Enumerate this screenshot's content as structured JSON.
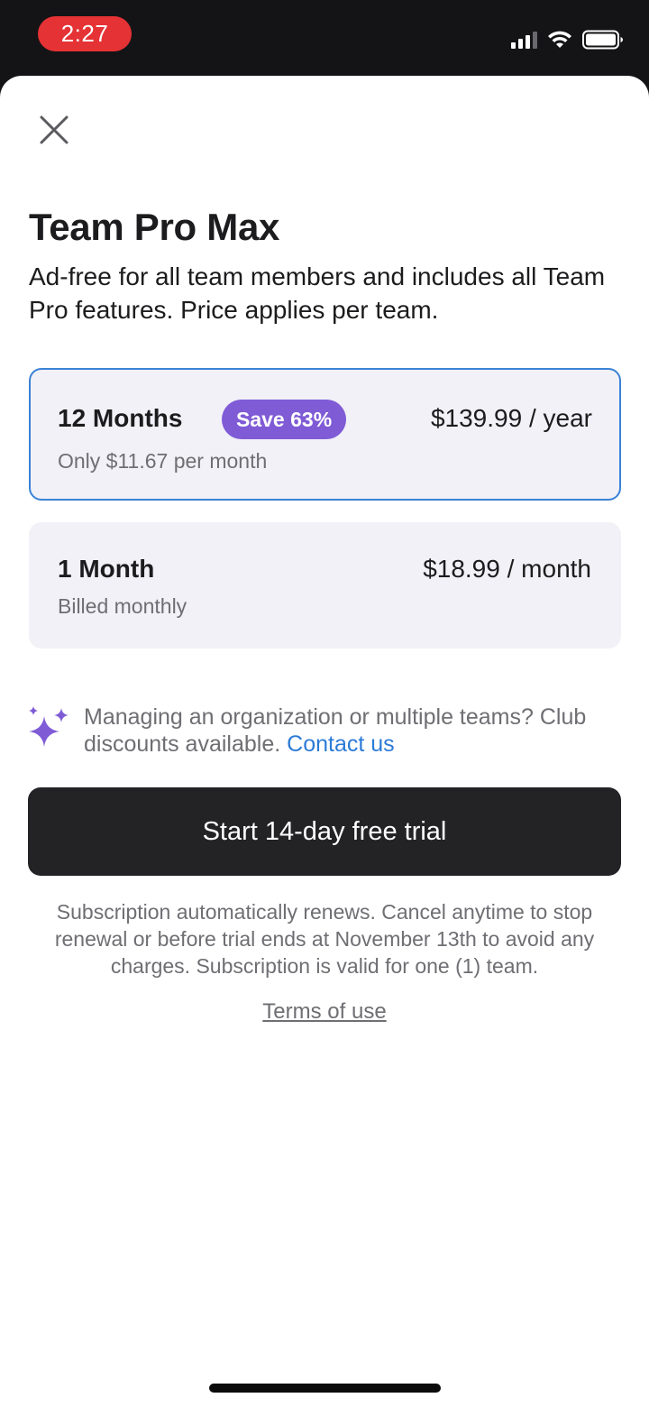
{
  "status_bar": {
    "time": "2:27",
    "icons": [
      "signal-icon",
      "wifi-icon",
      "battery-icon"
    ]
  },
  "sheet": {
    "close_icon": "close-icon",
    "title": "Team Pro Max",
    "subtitle": "Ad-free for all team members and includes all Team Pro features. Price applies per team.",
    "plans": [
      {
        "name": "12 Months",
        "badge": "Save 63%",
        "sub": "Only $11.67 per month",
        "price": "$139.99 / year",
        "selected": true
      },
      {
        "name": "1 Month",
        "sub": "Billed monthly",
        "price": "$18.99 / month",
        "selected": false
      }
    ],
    "club": {
      "icon": "sparkle-icon",
      "text": "Managing an organization or multiple teams? Club discounts available.",
      "link": "Contact us"
    },
    "cta_label": "Start 14-day free trial",
    "fineprint": "Subscription automatically renews. Cancel anytime to stop renewal or before trial ends at November 13th to avoid any charges. Subscription is valid for one (1) team.",
    "terms_label": "Terms of use"
  },
  "colors": {
    "accent_blue": "#3b82d6",
    "badge_purple": "#7f5bd6",
    "cta_dark": "#232326",
    "time_pill_red": "#e53235",
    "link_blue": "#2c7bd6"
  }
}
